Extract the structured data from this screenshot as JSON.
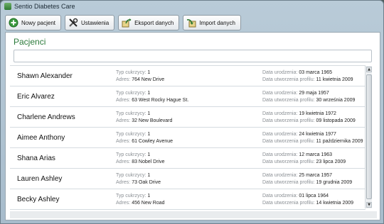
{
  "window": {
    "title": "Sentio Diabetes Care"
  },
  "toolbar": {
    "new_patient": "Nowy pacjent",
    "settings": "Ustawienia",
    "export": "Eksport danych",
    "import": "Import danych"
  },
  "section": {
    "title": "Pacjenci"
  },
  "search": {
    "value": "",
    "placeholder": ""
  },
  "labels": {
    "diabetes_type": "Typ cukrzycy:",
    "address": "Adres:",
    "birth_date": "Data urodzenia:",
    "profile_created": "Data utworzenia profilu:"
  },
  "patients": [
    {
      "name": "Shawn Alexander",
      "type": "1",
      "address": "764 New Drive",
      "birth": "03 marca 1965",
      "created": "11 kwietnia 2009"
    },
    {
      "name": "Eric Alvarez",
      "type": "1",
      "address": "63 West Rocky Hague St.",
      "birth": "29 maja 1957",
      "created": "30 września 2009"
    },
    {
      "name": "Charlene Andrews",
      "type": "1",
      "address": "32 New Boulevard",
      "birth": "19 kwietnia 1972",
      "created": "09 listopada 2009"
    },
    {
      "name": "Aimee Anthony",
      "type": "1",
      "address": "61 Cowley Avenue",
      "birth": "24 kwietnia 1977",
      "created": "11 października 2009"
    },
    {
      "name": "Shana Arias",
      "type": "1",
      "address": "83 Nobel Drive",
      "birth": "12 marca 1963",
      "created": "23 lipca 2009"
    },
    {
      "name": "Lauren Ashley",
      "type": "1",
      "address": "73 Oak Drive",
      "birth": "25 marca 1957",
      "created": "19 grudnia 2009"
    },
    {
      "name": "Becky Ashley",
      "type": "1",
      "address": "456 New Road",
      "birth": "01 lipca 1964",
      "created": "14 kwietnia 2009"
    }
  ],
  "icons": {
    "new_patient": "plus-circle-icon",
    "settings": "tools-icon",
    "export": "export-icon",
    "import": "import-icon"
  },
  "colors": {
    "section_title": "#2b7a3a",
    "label": "#8a8f94"
  }
}
